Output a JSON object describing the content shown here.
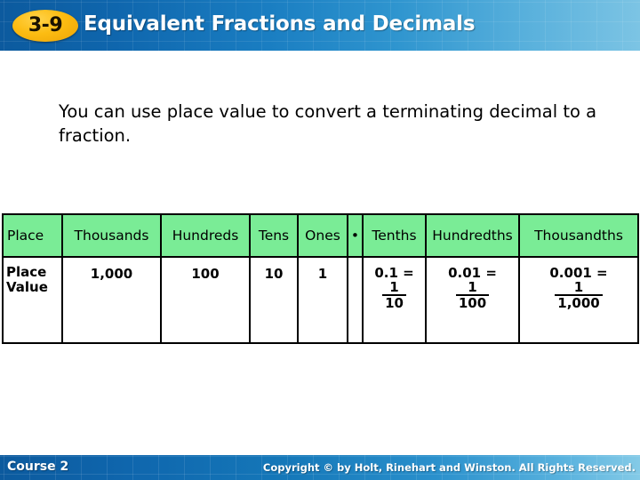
{
  "header": {
    "lesson_number": "3-9",
    "title": "Equivalent Fractions and Decimals",
    "accent_badge_color": "#fcbc12",
    "band_color_left": "#0c5a9e",
    "band_color_right": "#7cc4e4"
  },
  "main": {
    "lead_text": "You can use place value to convert a terminating decimal to a fraction."
  },
  "table": {
    "header_fill": "#7aec96",
    "row_label_header": "Place",
    "row_label_body": "Place Value",
    "columns": [
      {
        "header": "Thousands",
        "value": "1,000"
      },
      {
        "header": "Hundreds",
        "value": "100"
      },
      {
        "header": "Tens",
        "value": "10"
      },
      {
        "header": "Ones",
        "value": "1"
      },
      {
        "header": "•",
        "value": ""
      },
      {
        "header": "Tenths",
        "value": "0.1 =",
        "numerator": "1",
        "denominator": "10"
      },
      {
        "header": "Hundredths",
        "value": "0.01 =",
        "numerator": "1",
        "denominator": "100"
      },
      {
        "header": "Thousandths",
        "value": "0.001 =",
        "numerator": "1",
        "denominator": "1,000"
      }
    ]
  },
  "footer": {
    "course": "Course 2",
    "copyright": "Copyright © by Holt, Rinehart and Winston. All Rights Reserved."
  }
}
